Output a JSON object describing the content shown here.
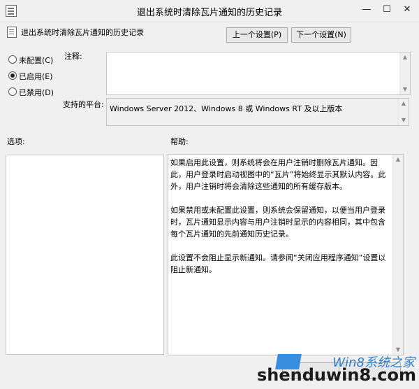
{
  "window": {
    "title": "退出系统时清除瓦片通知的历史记录",
    "controls": {
      "minimize": "—",
      "maximize": "☐",
      "close": "✕"
    }
  },
  "policy": {
    "name": "退出系统时清除瓦片通知的历史记录",
    "prev_button": "上一个设置(P)",
    "next_button": "下一个设置(N)"
  },
  "state": {
    "options": [
      {
        "label": "未配置(C)",
        "checked": false
      },
      {
        "label": "已启用(E)",
        "checked": true
      },
      {
        "label": "已禁用(D)",
        "checked": false
      }
    ]
  },
  "fields": {
    "comment_label": "注释:",
    "comment_value": "",
    "platform_label": "支持的平台:",
    "platform_value": "Windows Server 2012、Windows 8 或 Windows RT 及以上版本"
  },
  "sections": {
    "options_label": "选项:",
    "help_label": "帮助:"
  },
  "help": {
    "paragraphs": [
      "如果启用此设置，则系统将会在用户注销时删除瓦片通知。因此，用户登录时启动视图中的“瓦片”将始终显示其默认内容。此外，用户注销时将会清除这些通知的所有缓存版本。",
      "如果禁用或未配置此设置，则系统会保留通知，以便当用户登录时，瓦片通知显示内容与用户注销时显示的内容相同，其中包含每个瓦片通知的先前通知历史记录。",
      "此设置不会阻止显示新通知。请参阅“关闭应用程序通知”设置以阻止新通知。"
    ]
  },
  "watermark": {
    "site": "Win8系统之家",
    "url": "shenduwin8.com"
  },
  "icons": {
    "app": "policy-document-icon",
    "policy": "policy-document-icon"
  },
  "colors": {
    "background": "#f0f0f0",
    "watermark_blue": "#2f7fd0"
  }
}
